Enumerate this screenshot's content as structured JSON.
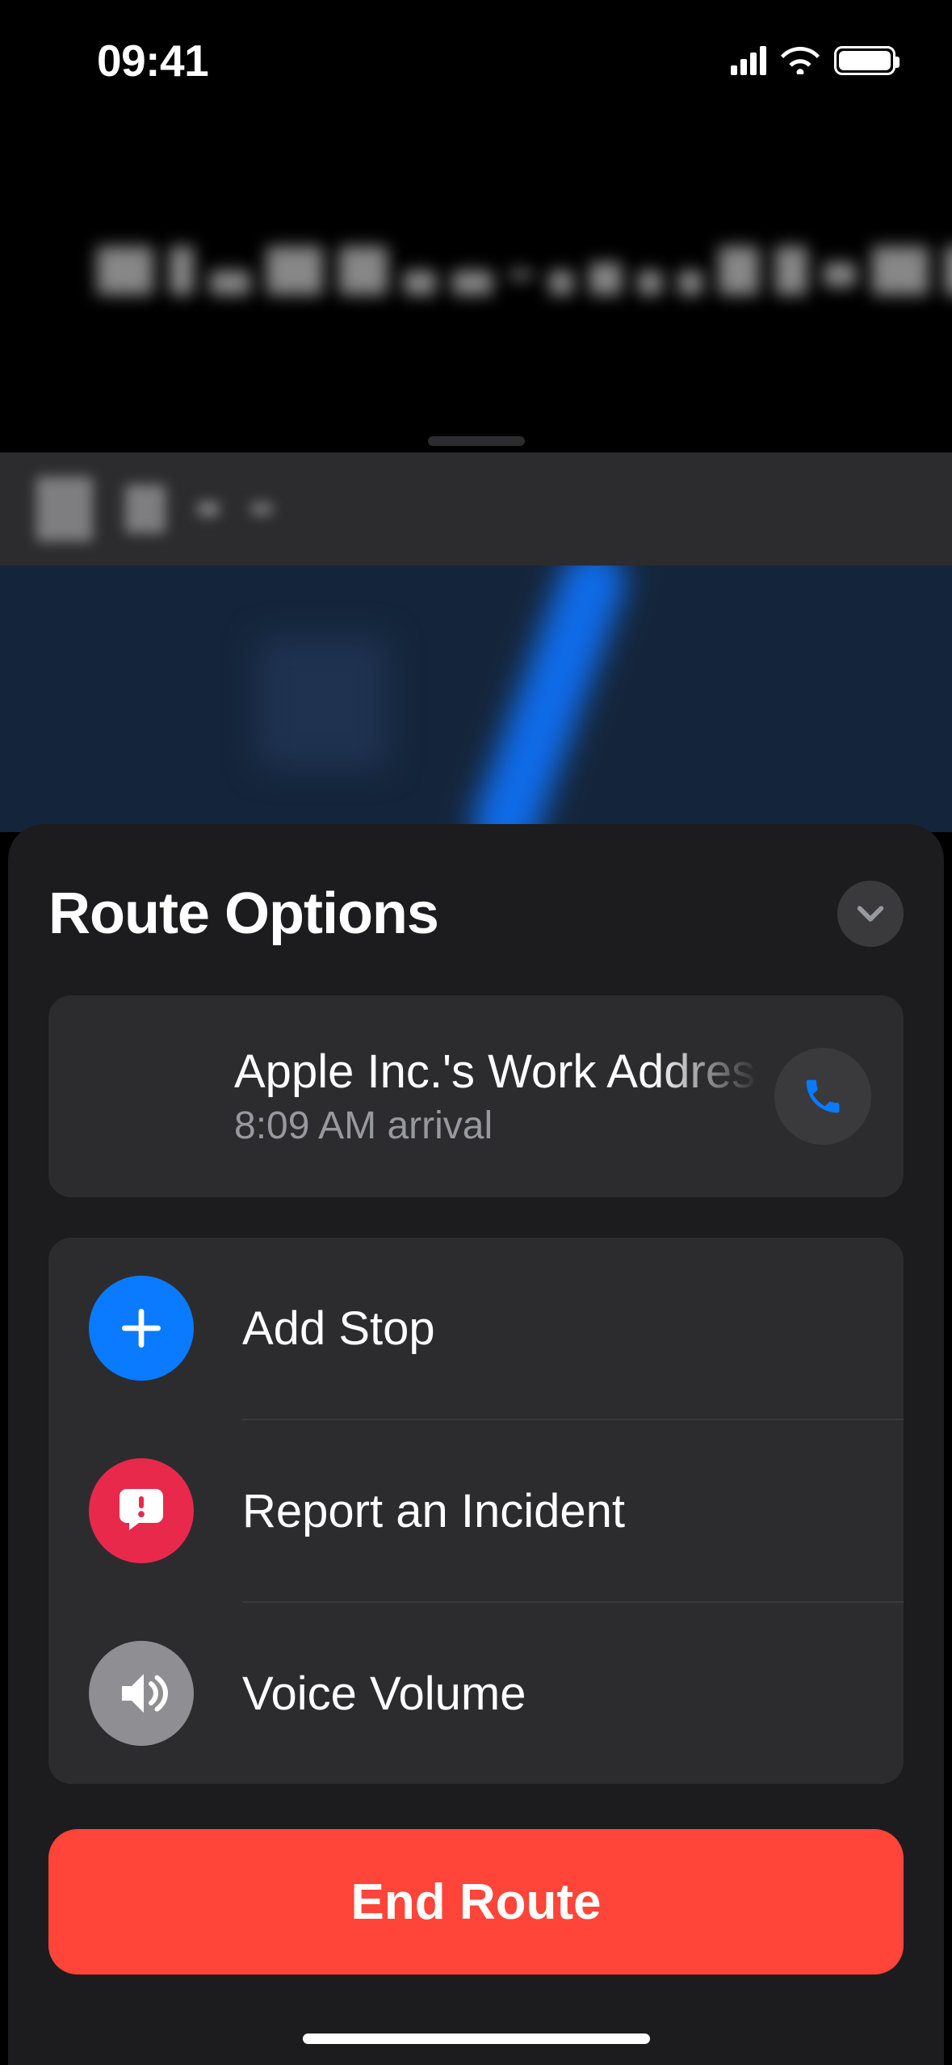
{
  "status": {
    "time": "09:41"
  },
  "sheet": {
    "title": "Route Options"
  },
  "destination": {
    "title": "Apple Inc.'s Work Address",
    "arrival": "8:09 AM arrival"
  },
  "options": {
    "add_stop": "Add Stop",
    "report": "Report an Incident",
    "voice": "Voice Volume"
  },
  "end_route_label": "End Route",
  "icons": {
    "collapse": "chevron-down",
    "call": "phone",
    "plus": "plus",
    "report": "chat-exclaim",
    "speaker": "speaker"
  },
  "colors": {
    "accent_blue": "#0a7aff",
    "accent_red": "#e8294c",
    "danger": "#ff453a",
    "sheet_bg": "#1c1c1e",
    "card_bg": "#2c2c2e"
  }
}
